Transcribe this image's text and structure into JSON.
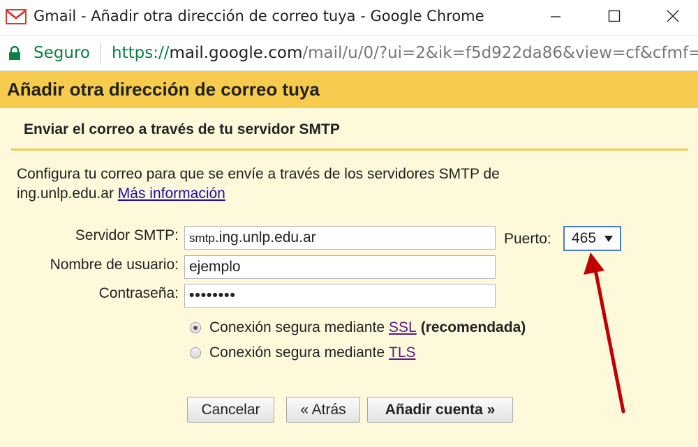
{
  "window": {
    "title": "Gmail - Añadir otra dirección de correo tuya - Google Chrome",
    "min_glyph": "—",
    "max_glyph": "☐",
    "close_glyph": "✕"
  },
  "address_bar": {
    "secure_label": "Seguro",
    "url_scheme": "https://",
    "url_host": "mail.google.com",
    "url_path": "/mail/u/0/?ui=2&ik=f5d922da86&view=cf&cfmf="
  },
  "page": {
    "heading": "Añadir otra dirección de correo tuya",
    "section_title": "Enviar el correo a través de tu servidor SMTP",
    "description": "Configura tu correo para que se envíe a través de los servidores SMTP de ing.unlp.edu.ar",
    "more_info_link": "Más información"
  },
  "form": {
    "smtp_label": "Servidor SMTP:",
    "smtp_value_prefix": "smtp",
    "smtp_value_rest": ".ing.unlp.edu.ar",
    "port_label": "Puerto:",
    "port_value": "465",
    "username_label": "Nombre de usuario:",
    "username_value": "ejemplo",
    "password_label": "Contraseña:",
    "password_value": "••••••••",
    "radio_ssl_text": "Conexión segura mediante",
    "radio_ssl_link": "SSL",
    "radio_ssl_note": "(recomendada)",
    "radio_tls_text": "Conexión segura mediante",
    "radio_tls_link": "TLS",
    "selected_security": "SSL"
  },
  "buttons": {
    "cancel": "Cancelar",
    "back": "« Atrás",
    "add": "Añadir cuenta »"
  },
  "colors": {
    "header_bg": "#f7cb4d",
    "content_bg": "#fff9db",
    "secure_green": "#0b8043",
    "annotation_arrow": "#c00000"
  },
  "icons": {
    "app": "gmail-icon",
    "lock": "lock-icon",
    "dropdown": "dropdown-triangle-icon"
  }
}
